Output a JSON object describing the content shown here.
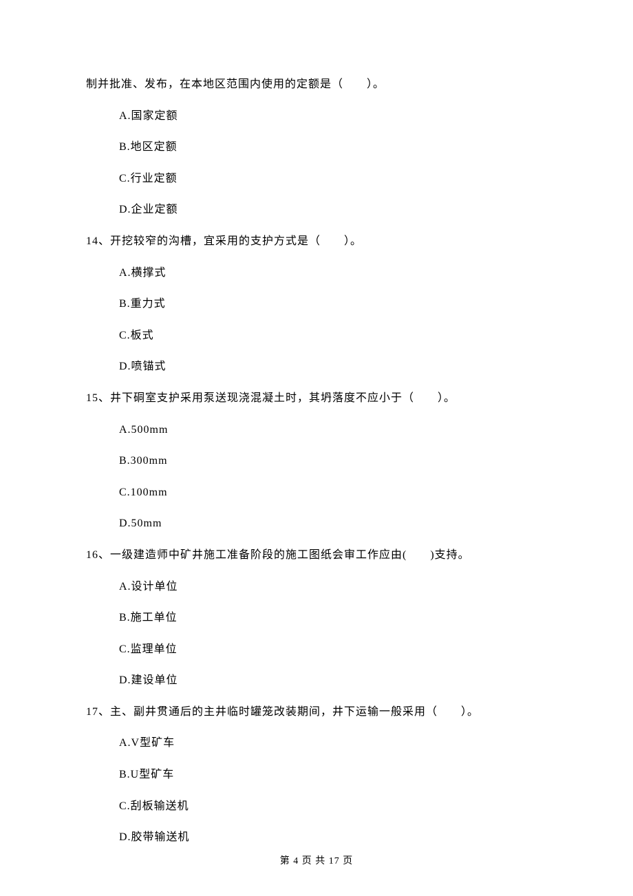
{
  "q13": {
    "stem_continued": "制并批准、发布，在本地区范围内使用的定额是（　　）。",
    "options": {
      "a": "A.国家定额",
      "b": "B.地区定额",
      "c": "C.行业定额",
      "d": "D.企业定额"
    }
  },
  "q14": {
    "stem": "14、开挖较窄的沟槽，宜采用的支护方式是（　　）。",
    "options": {
      "a": "A.横撑式",
      "b": "B.重力式",
      "c": "C.板式",
      "d": "D.喷锚式"
    }
  },
  "q15": {
    "stem": "15、井下硐室支护采用泵送现浇混凝土时，其坍落度不应小于（　　）。",
    "options": {
      "a": "A.500mm",
      "b": "B.300mm",
      "c": "C.100mm",
      "d": "D.50mm"
    }
  },
  "q16": {
    "stem": "16、一级建造师中矿井施工准备阶段的施工图纸会审工作应由(　　)支持。",
    "options": {
      "a": "A.设计单位",
      "b": "B.施工单位",
      "c": "C.监理单位",
      "d": "D.建设单位"
    }
  },
  "q17": {
    "stem": "17、主、副井贯通后的主井临时罐笼改装期间，井下运输一般采用（　　）。",
    "options": {
      "a": "A.V型矿车",
      "b": "B.U型矿车",
      "c": "C.刮板输送机",
      "d": "D.胶带输送机"
    }
  },
  "footer": "第 4 页 共 17 页"
}
